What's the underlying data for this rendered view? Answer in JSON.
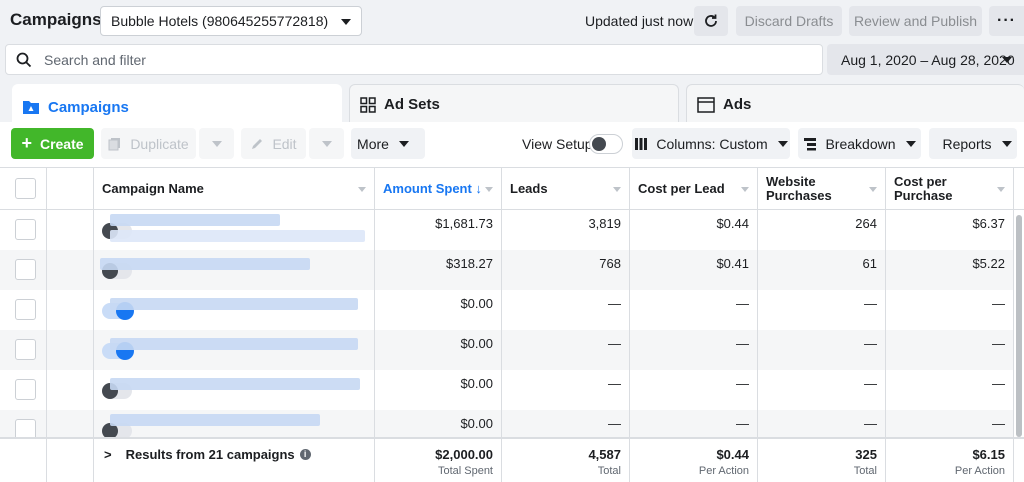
{
  "header": {
    "title": "Campaigns",
    "account": "Bubble Hotels (980645255772818)",
    "updated": "Updated just now",
    "discard_label": "Discard Drafts",
    "review_label": "Review and Publish",
    "more_label": "···"
  },
  "search": {
    "placeholder": "Search and filter",
    "value": ""
  },
  "date_range": "Aug 1, 2020 – Aug 28, 2020",
  "tabs": [
    {
      "label": "Campaigns",
      "icon": "folder-icon",
      "active": true
    },
    {
      "label": "Ad Sets",
      "icon": "grid-icon",
      "active": false
    },
    {
      "label": "Ads",
      "icon": "ad-window-icon",
      "active": false
    }
  ],
  "toolbar": {
    "create_label": "Create",
    "duplicate_label": "Duplicate",
    "edit_label": "Edit",
    "more_label": "More",
    "view_setup_label": "View Setup",
    "columns_label": "Columns: Custom",
    "breakdown_label": "Breakdown",
    "reports_label": "Reports"
  },
  "table": {
    "columns": [
      {
        "label": "Campaign Name"
      },
      {
        "label": "Amount Spent ↓",
        "sorted": true
      },
      {
        "label": "Leads"
      },
      {
        "label": "Cost per Lead"
      },
      {
        "label": "Website Purchases"
      },
      {
        "label": "Cost per Purchase"
      }
    ],
    "rows": [
      {
        "on": false,
        "spent": "$1,681.73",
        "leads": "3,819",
        "cpl": "$0.44",
        "purchases": "264",
        "cpp": "$6.37"
      },
      {
        "on": false,
        "spent": "$318.27",
        "leads": "768",
        "cpl": "$0.41",
        "purchases": "61",
        "cpp": "$5.22"
      },
      {
        "on": true,
        "spent": "$0.00",
        "leads": "—",
        "cpl": "—",
        "purchases": "—",
        "cpp": "—"
      },
      {
        "on": true,
        "spent": "$0.00",
        "leads": "—",
        "cpl": "—",
        "purchases": "—",
        "cpp": "—"
      },
      {
        "on": false,
        "spent": "$0.00",
        "leads": "—",
        "cpl": "—",
        "purchases": "—",
        "cpp": "—"
      },
      {
        "on": false,
        "spent": "$0.00",
        "leads": "—",
        "cpl": "—",
        "purchases": "—",
        "cpp": "—"
      }
    ],
    "footer": {
      "results_label": "Results from 21 campaigns",
      "spent": "$2,000.00",
      "spent_sub": "Total Spent",
      "leads": "4,587",
      "leads_sub": "Total",
      "cpl": "$0.44",
      "cpl_sub": "Per Action",
      "purchases": "325",
      "purchases_sub": "Total",
      "cpp": "$6.15",
      "cpp_sub": "Per Action"
    }
  },
  "colors": {
    "accent": "#1877f2",
    "create": "#42b72a"
  }
}
